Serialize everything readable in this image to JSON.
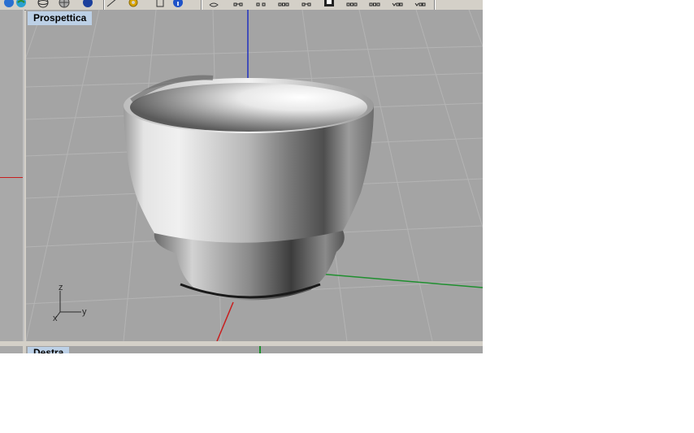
{
  "toolbar": {
    "icons": [
      "render-sphere-icon",
      "globe-icon",
      "wire-sphere-icon",
      "network-icon",
      "shaded-sphere-icon",
      "gear-icon",
      "bracket-icon",
      "info-icon",
      "spiral-icon",
      "snap-1-icon",
      "snap-2-icon",
      "snap-3-icon",
      "snap-4-icon",
      "snap-5-icon",
      "snap-6-icon",
      "snap-7-icon",
      "snap-8-icon",
      "snap-9-icon"
    ]
  },
  "viewports": {
    "perspective": {
      "title": "Prospettica"
    },
    "right": {
      "title": "Destra"
    }
  },
  "axis_gizmo": {
    "z": "z",
    "y": "y",
    "x": "x"
  },
  "colors": {
    "viewport_bg": "#a4a4a4",
    "title_bg": "#bcd0e6",
    "x_axis": "#c81e1e",
    "y_axis": "#1f8f2f",
    "z_axis": "#2030c0"
  }
}
